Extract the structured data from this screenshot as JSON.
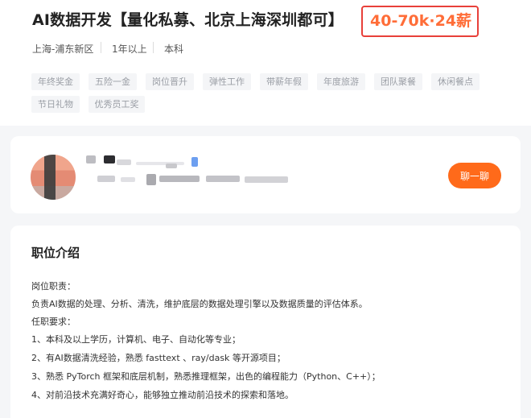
{
  "job": {
    "title": "AI数据开发【量化私募、北京上海深圳都可】",
    "salary": "40-70k·24薪",
    "location": "上海-浦东新区",
    "experience": "1年以上",
    "education": "本科",
    "tags": [
      "年终奖金",
      "五险一金",
      "岗位晋升",
      "弹性工作",
      "带薪年假",
      "年度旅游",
      "团队聚餐",
      "休闲餐点",
      "节日礼物",
      "优秀员工奖"
    ]
  },
  "recruiter": {
    "chat_label": "聊一聊"
  },
  "description": {
    "title": "职位介绍",
    "lines": [
      "岗位职责：",
      "负责AI数据的处理、分析、清洗，维护底层的数据处理引擎以及数据质量的评估体系。",
      "任职要求：",
      "1、本科及以上学历，计算机、电子、自动化等专业；",
      "2、有AI数据清洗经验，熟悉 fasttext 、ray/dask 等开源项目；",
      "3、熟悉 PyTorch 框架和底层机制，熟悉推理框架，出色的编程能力（Python、C++）；",
      "4、对前沿技术充满好奇心，能够独立推动前沿技术的探索和落地。"
    ]
  },
  "colors": {
    "accent": "#ff6a1a",
    "salary": "#ff6d38",
    "highlight_border": "#e8403a"
  }
}
